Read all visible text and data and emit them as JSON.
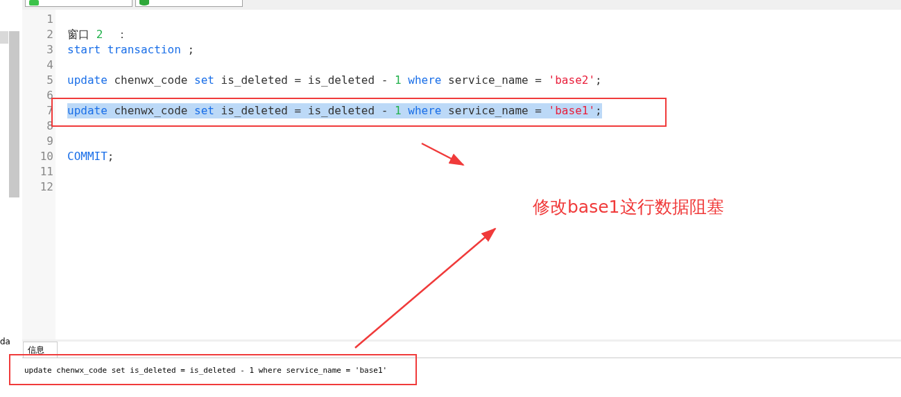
{
  "left_panel": {
    "fragment": "da"
  },
  "editor": {
    "lines": [
      {
        "number": "1"
      },
      {
        "number": "2",
        "selected": false,
        "tokens": [
          {
            "kind": "plain",
            "text": "窗口 "
          },
          {
            "kind": "number",
            "text": "2"
          },
          {
            "kind": "plain",
            "text": "  ："
          }
        ]
      },
      {
        "number": "3",
        "selected": false,
        "tokens": [
          {
            "kind": "keyword",
            "text": "start transaction"
          },
          {
            "kind": "plain",
            "text": " ;"
          }
        ]
      },
      {
        "number": "4"
      },
      {
        "number": "5",
        "selected": false,
        "tokens": [
          {
            "kind": "keyword",
            "text": "update"
          },
          {
            "kind": "plain",
            "text": " chenwx_code "
          },
          {
            "kind": "keyword",
            "text": "set"
          },
          {
            "kind": "plain",
            "text": " is_deleted = is_deleted - "
          },
          {
            "kind": "number",
            "text": "1"
          },
          {
            "kind": "keyword",
            "text": " where"
          },
          {
            "kind": "plain",
            "text": " service_name = "
          },
          {
            "kind": "string",
            "text": "'base2'"
          },
          {
            "kind": "plain",
            "text": ";"
          }
        ]
      },
      {
        "number": "6"
      },
      {
        "number": "7",
        "selected": true,
        "tokens": [
          {
            "kind": "keyword",
            "text": "update"
          },
          {
            "kind": "plain",
            "text": " chenwx_code "
          },
          {
            "kind": "keyword",
            "text": "set"
          },
          {
            "kind": "plain",
            "text": " is_deleted = is_deleted - "
          },
          {
            "kind": "number",
            "text": "1"
          },
          {
            "kind": "keyword",
            "text": " where"
          },
          {
            "kind": "plain",
            "text": " service_name = "
          },
          {
            "kind": "string",
            "text": "'base1'"
          },
          {
            "kind": "plain",
            "text": ";"
          }
        ]
      },
      {
        "number": "8"
      },
      {
        "number": "9"
      },
      {
        "number": "10",
        "selected": false,
        "tokens": [
          {
            "kind": "keyword",
            "text": "COMMIT"
          },
          {
            "kind": "plain",
            "text": ";"
          }
        ]
      },
      {
        "number": "11"
      },
      {
        "number": "12"
      }
    ]
  },
  "info_panel": {
    "tab": {
      "label": "信息",
      "selected": true
    },
    "message": "update chenwx_code set is_deleted = is_deleted - 1 where service_name = 'base1'"
  },
  "annotation": {
    "text": "修改base1这行数据阻塞"
  }
}
